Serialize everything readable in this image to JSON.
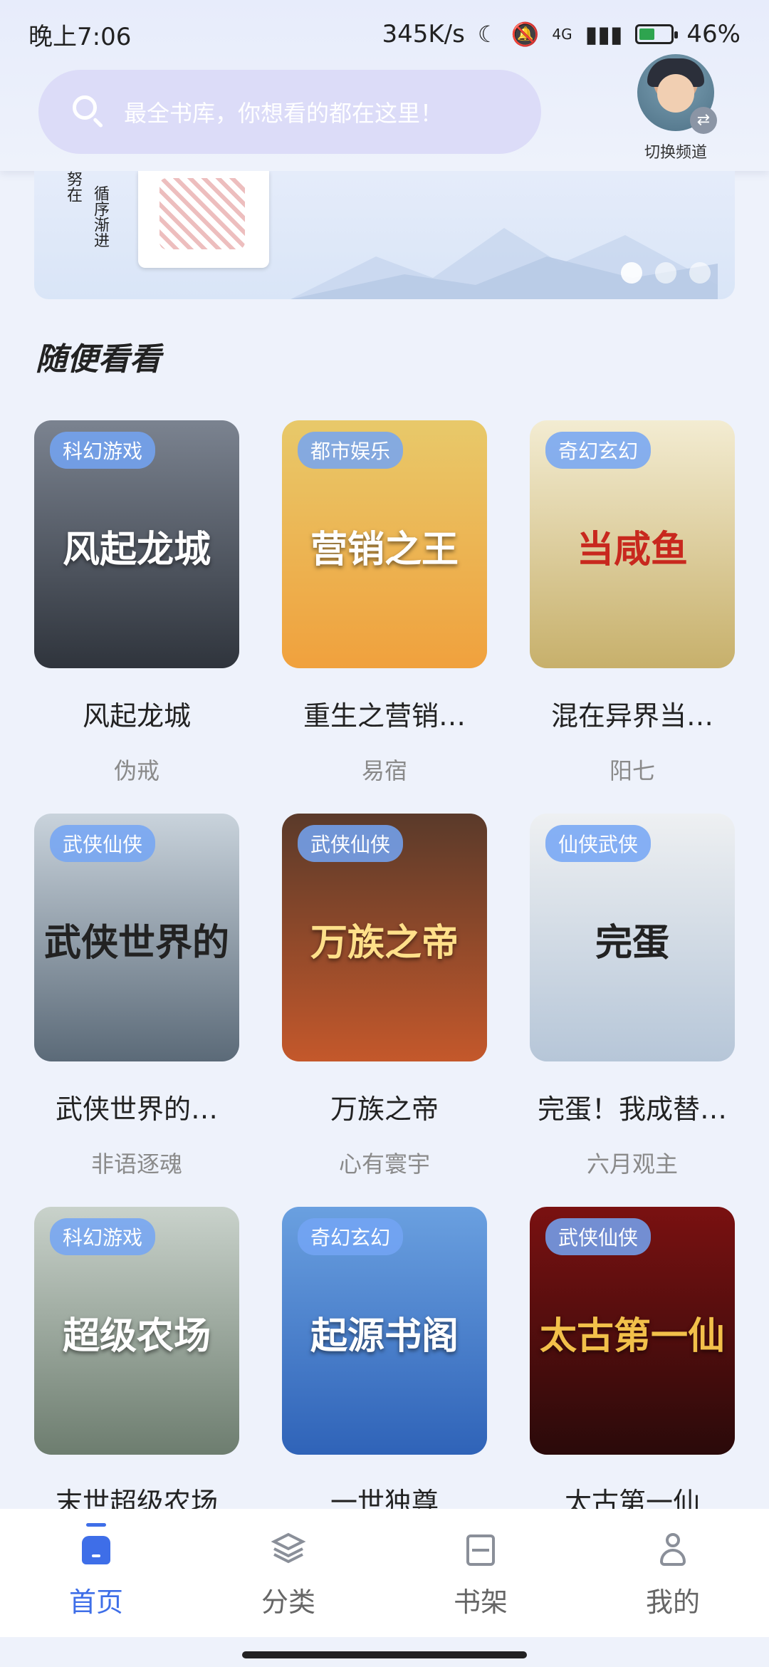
{
  "status_bar": {
    "time": "晚上7:06",
    "net_speed": "345K/s",
    "battery": "46%",
    "battery_level_percent": 46,
    "signal": "4G"
  },
  "header": {
    "search_placeholder": "最全书库，你想看的都在这里！",
    "switch_label": "切换频道"
  },
  "banner": {
    "text_col1": "努在",
    "text_col2": "循序渐进",
    "page_count": 3,
    "active_index": 0
  },
  "section": {
    "title": "随便看看"
  },
  "books": [
    {
      "tag": "科幻游戏",
      "cover_text": "风起龙城",
      "title": "风起龙城",
      "author": "伪戒",
      "cover_colors": [
        "#7b8390",
        "#2f343c"
      ]
    },
    {
      "tag": "都市娱乐",
      "cover_text": "营销之王",
      "title": "重生之营销…",
      "author": "易宿",
      "cover_colors": [
        "#e8c96a",
        "#f0a13d"
      ]
    },
    {
      "tag": "奇幻玄幻",
      "cover_text": "当咸鱼",
      "title": "混在异界当…",
      "author": "阳七",
      "cover_colors": [
        "#f3ecd2",
        "#c7b06b"
      ]
    },
    {
      "tag": "武侠仙侠",
      "cover_text": "武侠世界的",
      "title": "武侠世界的…",
      "author": "非语逐魂",
      "cover_colors": [
        "#c9d3dc",
        "#5b6a78"
      ]
    },
    {
      "tag": "武侠仙侠",
      "cover_text": "万族之帝",
      "title": "万族之帝",
      "author": "心有寰宇",
      "cover_colors": [
        "#5a3a2a",
        "#c4582b"
      ]
    },
    {
      "tag": "仙侠武侠",
      "cover_text": "完蛋",
      "title": "完蛋！我成替…",
      "author": "六月观主",
      "cover_colors": [
        "#eef0f2",
        "#b6c6d8"
      ]
    },
    {
      "tag": "科幻游戏",
      "cover_text": "超级农场",
      "title": "末世超级农场",
      "author": "",
      "cover_colors": [
        "#c9d2cb",
        "#6d7d6f"
      ]
    },
    {
      "tag": "奇幻玄幻",
      "cover_text": "起源书阁",
      "title": "一世独尊",
      "author": "",
      "cover_colors": [
        "#6aa0e0",
        "#2f63b8"
      ]
    },
    {
      "tag": "武侠仙侠",
      "cover_text": "太古第一仙",
      "title": "太古第一仙",
      "author": "",
      "cover_colors": [
        "#7a1111",
        "#2a0a0a"
      ]
    }
  ],
  "bottom_nav": {
    "items": [
      {
        "label": "首页",
        "icon": "home-icon",
        "active": true
      },
      {
        "label": "分类",
        "icon": "layers-icon",
        "active": false
      },
      {
        "label": "书架",
        "icon": "bookshelf-icon",
        "active": false
      },
      {
        "label": "我的",
        "icon": "user-icon",
        "active": false
      }
    ]
  },
  "colors": {
    "accent": "#3e6ee8",
    "tag_bg": "#73a5f5"
  }
}
